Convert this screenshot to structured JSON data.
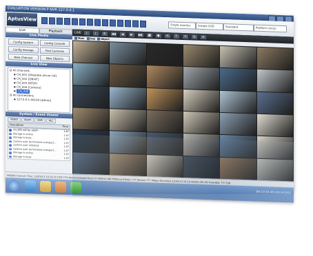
{
  "window": {
    "title": "EVALUATION VERSION   P NVR   127.0.0.1"
  },
  "toolbar": {
    "logo": "AptusView",
    "selects": [
      "Single monitor",
      "Simple OSD",
      "Standard",
      "Platform (only)"
    ]
  },
  "left_panel": {
    "tabs": [
      "Live",
      "Playback"
    ],
    "live_media_header": "Live Media",
    "buttons": [
      "Config System",
      "Config Console",
      "Config Storage",
      "Find Cameras",
      "New Channel",
      "New Objects"
    ],
    "tree_header": "Live View",
    "tree": [
      {
        "label": "All channels",
        "level": 0,
        "selected": false
      },
      {
        "label": "CH_001 [Obsolete server 04]",
        "level": 1,
        "selected": false
      },
      {
        "label": "CH_002 [ONVIF]",
        "level": 1,
        "selected": false
      },
      {
        "label": "CH_003 [RTSP]",
        "level": 1,
        "selected": false
      },
      {
        "label": "CH_004 [Camera]",
        "level": 1,
        "selected": false
      },
      {
        "label": "CH_005",
        "level": 1,
        "selected": true
      },
      {
        "label": "All connections",
        "level": 0,
        "selected": false
      },
      {
        "label": "127.0.0.1:46100 [admin]",
        "level": 1,
        "selected": false
      }
    ],
    "events_header": "System / Event Viewer",
    "event_tabs": [
      "VIDEO",
      "Alarm",
      "DVR",
      "ALL"
    ],
    "event_columns": [
      "Description",
      "Time"
    ],
    "events": [
      {
        "text": "CH_005 will be alarm",
        "time": "1:0?"
      },
      {
        "text": "Storage is online",
        "time": "1:0?"
      },
      {
        "text": "Storage is busy",
        "time": "1:0?"
      },
      {
        "text": "Custom user terminated unexpect...",
        "time": "1:0?"
      },
      {
        "text": "Custom user initiated",
        "time": "1:0?"
      },
      {
        "text": "Custom user terminated unexpect...",
        "time": "1:0?"
      },
      {
        "text": "Storage is online",
        "time": "1:0?"
      },
      {
        "text": "Storage is busy",
        "time": "1:0?"
      }
    ]
  },
  "video": {
    "toolbar_label": "LIVE",
    "controls": [
      "I",
      "|",
      "B",
      "◀◀",
      "◀",
      "▶",
      "▶▶",
      "■",
      "●",
      "⟲",
      "T",
      "✕",
      "Q",
      "⟳"
    ],
    "subtabs": [
      "Main",
      "Sub",
      "Object"
    ],
    "tile_colors": [
      [
        "#c4b49a",
        "#7a8fa0",
        "#2a2a2a",
        "#9a8a6e",
        "#c8c2b4",
        "#8b7a62"
      ],
      [
        "#8ab0c8",
        "#6e5a44",
        "#b08a60",
        "#a0a8ac",
        "#4a6a8a",
        "#c0c8cc"
      ],
      [
        "#3a4a5a",
        "#9ab8d0",
        "#c2945a",
        "#d8d0c0",
        "#b0c4d4",
        "#5a7090"
      ],
      [
        "#a08c70",
        "#c8c0ac",
        "#7a6e60",
        "#d0c8b8",
        "#8ca0b4",
        "#e0dcd0"
      ],
      [
        "#2c3c50",
        "#8aa6c0",
        "#4a5c70",
        "#b6b6b0",
        "#6a88a6",
        "#d8d4c8"
      ],
      [
        "#5a6e88",
        "#a49078",
        "#c8c8c0",
        "#384858",
        "#9a7a58",
        "#c0c0b8"
      ]
    ]
  },
  "statusbar": {
    "text": "PMSM(?)   Server Time: 12/03/13 10:19:31   CPU:??%   Memory(single,free):?/? (M)512 (M)   FPS(Live)(Total): ???   Stream:???.?Mbps   Recorded:12/03/13 10:19 49203 (M) HD   FreeHDD: ???.?GB"
  },
  "taskbar": {
    "tray_text": "EN 10:19 AM 2013/12/03"
  }
}
